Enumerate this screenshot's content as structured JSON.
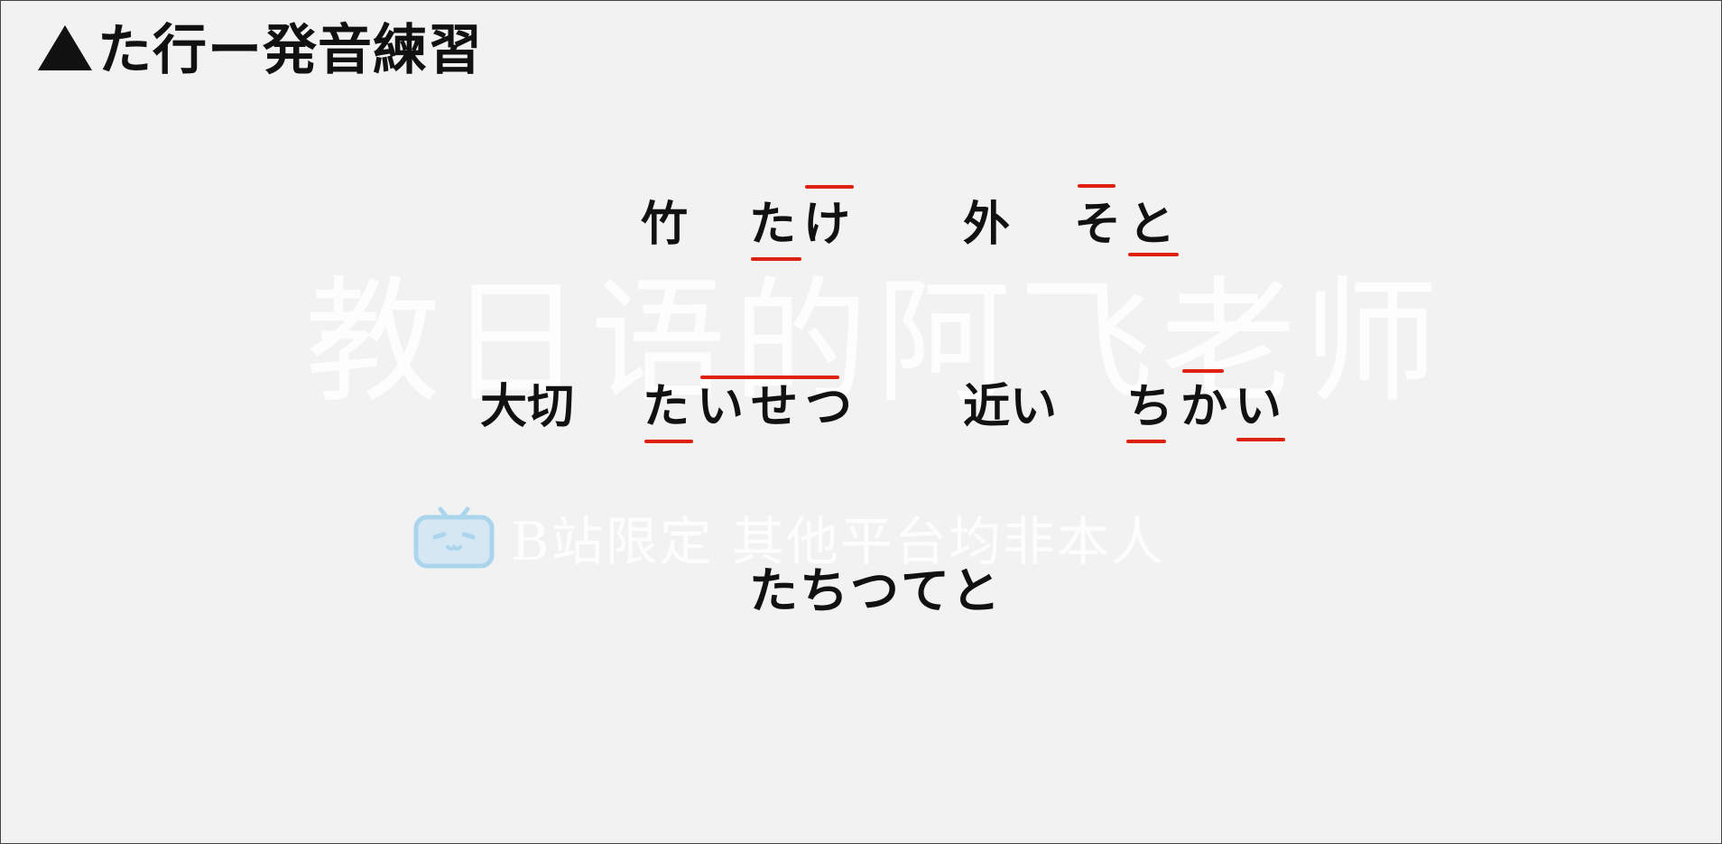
{
  "title": "たㄒ行ー発音練習",
  "title_text": "た行ー発音練習",
  "watermark": {
    "main": "教日语的阿飞老师",
    "sub": "B站限定 其他平台均非本人",
    "icon": "bilibili-tv-icon"
  },
  "words": [
    {
      "kanji": "竹",
      "kana": [
        "た",
        "け"
      ]
    },
    {
      "kanji": "外",
      "kana": [
        "そ",
        "と"
      ]
    },
    {
      "kanji": "大切",
      "kana": [
        "た",
        "い",
        "せ",
        "つ"
      ]
    },
    {
      "kanji": "近い",
      "kana": [
        "ち",
        "か",
        "い"
      ]
    }
  ],
  "drill": "たちつてと",
  "colors": {
    "background": "#f2f2f2",
    "text": "#111111",
    "accent_mark": "#e02010",
    "watermark": "#ffffff",
    "watermark_icon": "#9fd0ec"
  }
}
